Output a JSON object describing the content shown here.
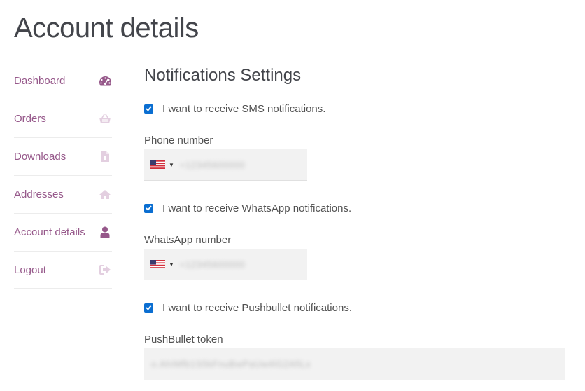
{
  "page": {
    "title": "Account details"
  },
  "sidebar": {
    "items": [
      {
        "label": "Dashboard",
        "icon": "dashboard-icon",
        "active": false
      },
      {
        "label": "Orders",
        "icon": "basket-icon",
        "active": false
      },
      {
        "label": "Downloads",
        "icon": "file-icon",
        "active": false
      },
      {
        "label": "Addresses",
        "icon": "home-icon",
        "active": false
      },
      {
        "label": "Account details",
        "icon": "user-icon",
        "active": true
      },
      {
        "label": "Logout",
        "icon": "sign-out-icon",
        "active": false
      }
    ]
  },
  "notifications": {
    "title": "Notifications Settings",
    "sms": {
      "label": "I want to receive SMS notifications.",
      "checked": true
    },
    "phone": {
      "label": "Phone number",
      "country": "US",
      "value": "+12345600000"
    },
    "whatsapp": {
      "label": "I want to receive WhatsApp notifications.",
      "checked": true
    },
    "whatsapp_phone": {
      "label": "WhatsApp number",
      "country": "US",
      "value": "+12345600000"
    },
    "pushbullet": {
      "label": "I want to receive Pushbullet notifications.",
      "checked": true
    },
    "token": {
      "label": "PushBullet token",
      "value": "o.AhIMfb1S5kFnuBwPaUw4lG2AfiLx"
    }
  },
  "colors": {
    "accent": "#96588a",
    "checkbox": "#0a6ed1",
    "input_bg": "#f2f2f2",
    "icon_muted": "#e3cfe0"
  }
}
